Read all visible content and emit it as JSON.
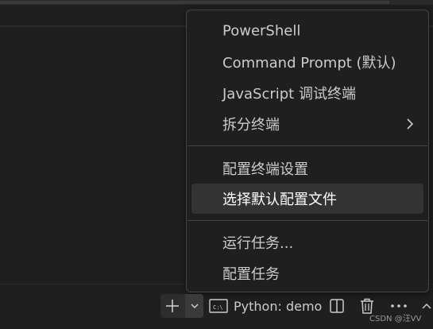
{
  "terminal_menu": {
    "items": [
      {
        "label": "PowerShell"
      },
      {
        "label": "Command Prompt (默认)"
      },
      {
        "label": "JavaScript 调试终端"
      },
      {
        "label": "拆分终端",
        "submenu": true
      },
      {
        "label": "配置终端设置"
      },
      {
        "label": "选择默认配置文件",
        "selected": true
      },
      {
        "label": "运行任务..."
      },
      {
        "label": "配置任务"
      }
    ]
  },
  "panel_toolbar": {
    "active_terminal": "Python: demo",
    "icons": [
      "plus-icon",
      "chevron-down-icon",
      "terminal-icon",
      "split-icon",
      "trash-icon",
      "more-icon",
      "chevron-up-icon"
    ]
  },
  "watermark": "CSDN @汪VV"
}
